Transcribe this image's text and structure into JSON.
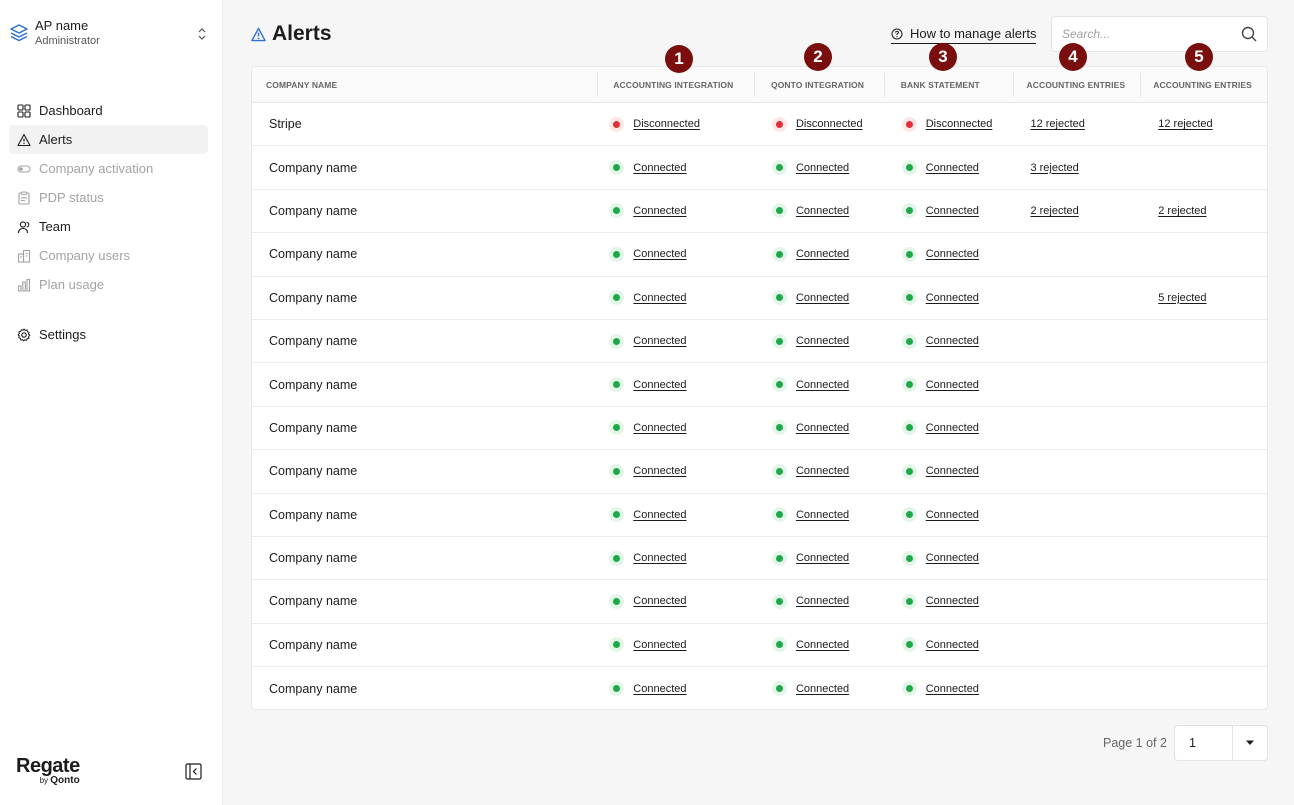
{
  "account": {
    "name": "AP name",
    "role": "Administrator"
  },
  "nav": [
    {
      "label": "Dashboard",
      "icon": "dashboard-icon",
      "state": "normal"
    },
    {
      "label": "Alerts",
      "icon": "alert-icon",
      "state": "active"
    },
    {
      "label": "Company activation",
      "icon": "toggle-icon",
      "state": "muted"
    },
    {
      "label": "PDP status",
      "icon": "clipboard-icon",
      "state": "muted"
    },
    {
      "label": "Team",
      "icon": "team-icon",
      "state": "normal"
    },
    {
      "label": "Company users",
      "icon": "building-icon",
      "state": "muted"
    },
    {
      "label": "Plan usage",
      "icon": "bar-chart-icon",
      "state": "muted"
    }
  ],
  "settings_label": "Settings",
  "brand": {
    "logo": "Regate",
    "by": "by",
    "by_brand": "Qonto"
  },
  "header": {
    "title": "Alerts",
    "manage_link": "How to manage alerts"
  },
  "search": {
    "placeholder": "Search..."
  },
  "markers": [
    "1",
    "2",
    "3",
    "4",
    "5"
  ],
  "table": {
    "columns": [
      "Company name",
      "Accounting integration",
      "Qonto integration",
      "Bank statement",
      "Accounting entries",
      "Accounting entries"
    ],
    "rows": [
      {
        "company": "Stripe",
        "acc": "Disconnected",
        "acc_ok": false,
        "qonto": "Disconnected",
        "qonto_ok": false,
        "bank": "Disconnected",
        "bank_ok": false,
        "entries1": "12 rejected",
        "entries2": "12 rejected"
      },
      {
        "company": "Company name",
        "acc": "Connected",
        "acc_ok": true,
        "qonto": "Connected",
        "qonto_ok": true,
        "bank": "Connected",
        "bank_ok": true,
        "entries1": "3 rejected",
        "entries2": ""
      },
      {
        "company": "Company name",
        "acc": "Connected",
        "acc_ok": true,
        "qonto": "Connected",
        "qonto_ok": true,
        "bank": "Connected",
        "bank_ok": true,
        "entries1": "2 rejected",
        "entries2": "2 rejected"
      },
      {
        "company": "Company name",
        "acc": "Connected",
        "acc_ok": true,
        "qonto": "Connected",
        "qonto_ok": true,
        "bank": "Connected",
        "bank_ok": true,
        "entries1": "",
        "entries2": ""
      },
      {
        "company": "Company name",
        "acc": "Connected",
        "acc_ok": true,
        "qonto": "Connected",
        "qonto_ok": true,
        "bank": "Connected",
        "bank_ok": true,
        "entries1": "",
        "entries2": "5 rejected"
      },
      {
        "company": "Company name",
        "acc": "Connected",
        "acc_ok": true,
        "qonto": "Connected",
        "qonto_ok": true,
        "bank": "Connected",
        "bank_ok": true,
        "entries1": "",
        "entries2": ""
      },
      {
        "company": "Company name",
        "acc": "Connected",
        "acc_ok": true,
        "qonto": "Connected",
        "qonto_ok": true,
        "bank": "Connected",
        "bank_ok": true,
        "entries1": "",
        "entries2": ""
      },
      {
        "company": "Company name",
        "acc": "Connected",
        "acc_ok": true,
        "qonto": "Connected",
        "qonto_ok": true,
        "bank": "Connected",
        "bank_ok": true,
        "entries1": "",
        "entries2": ""
      },
      {
        "company": "Company name",
        "acc": "Connected",
        "acc_ok": true,
        "qonto": "Connected",
        "qonto_ok": true,
        "bank": "Connected",
        "bank_ok": true,
        "entries1": "",
        "entries2": ""
      },
      {
        "company": "Company name",
        "acc": "Connected",
        "acc_ok": true,
        "qonto": "Connected",
        "qonto_ok": true,
        "bank": "Connected",
        "bank_ok": true,
        "entries1": "",
        "entries2": ""
      },
      {
        "company": "Company name",
        "acc": "Connected",
        "acc_ok": true,
        "qonto": "Connected",
        "qonto_ok": true,
        "bank": "Connected",
        "bank_ok": true,
        "entries1": "",
        "entries2": ""
      },
      {
        "company": "Company name",
        "acc": "Connected",
        "acc_ok": true,
        "qonto": "Connected",
        "qonto_ok": true,
        "bank": "Connected",
        "bank_ok": true,
        "entries1": "",
        "entries2": ""
      },
      {
        "company": "Company name",
        "acc": "Connected",
        "acc_ok": true,
        "qonto": "Connected",
        "qonto_ok": true,
        "bank": "Connected",
        "bank_ok": true,
        "entries1": "",
        "entries2": ""
      },
      {
        "company": "Company name",
        "acc": "Connected",
        "acc_ok": true,
        "qonto": "Connected",
        "qonto_ok": true,
        "bank": "Connected",
        "bank_ok": true,
        "entries1": "",
        "entries2": ""
      }
    ]
  },
  "pagination": {
    "label": "Page 1 of 2",
    "current": "1"
  },
  "colors": {
    "connected": "#1ea84a",
    "disconnected": "#e0313a",
    "marker": "#7a0d0d",
    "accent": "#2f6fd1"
  }
}
